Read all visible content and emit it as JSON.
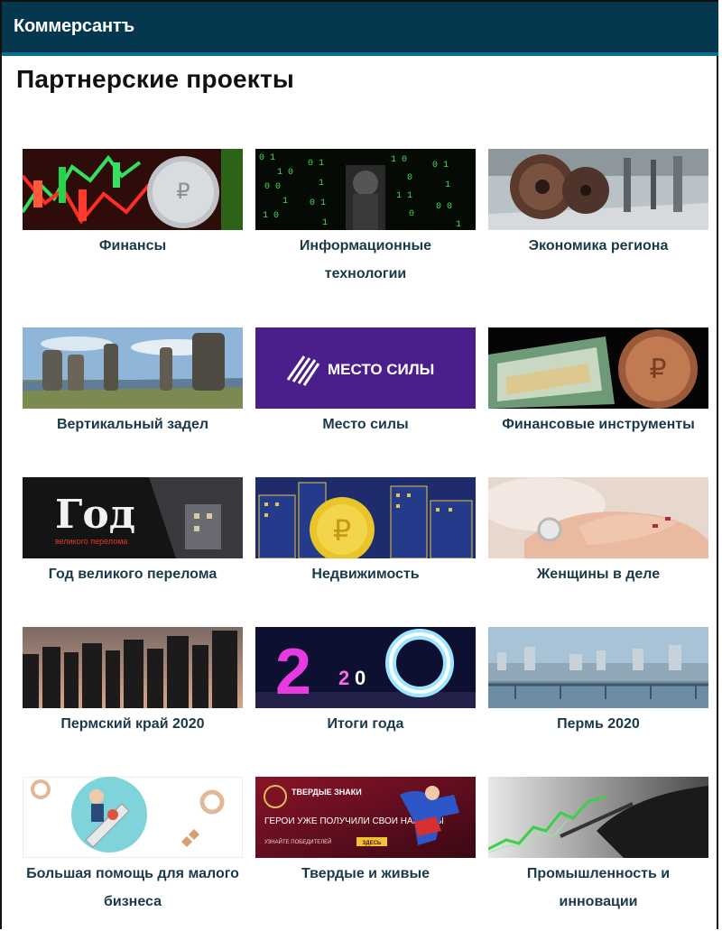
{
  "header": {
    "logo": "Коммерсантъ"
  },
  "page": {
    "title": "Партнерские проекты"
  },
  "projects": [
    {
      "label": "Финансы"
    },
    {
      "label": "Информационные технологии"
    },
    {
      "label": "Экономика региона"
    },
    {
      "label": "Вертикальный задел"
    },
    {
      "label": "Место силы",
      "image_text": "МЕСТО СИЛЫ"
    },
    {
      "label": "Финансовые инструменты"
    },
    {
      "label": "Год великого перелома",
      "image_text": "Год",
      "image_subtext": "великого перелома"
    },
    {
      "label": "Недвижимость"
    },
    {
      "label": "Женщины в деле"
    },
    {
      "label": "Пермский край 2020"
    },
    {
      "label": "Итоги года",
      "image_text": "2020"
    },
    {
      "label": "Пермь 2020"
    },
    {
      "label": "Большая помощь для малого бизнеса"
    },
    {
      "label": "Твердые и живые",
      "image_brand": "ТВЕРДЫЕ ЗНАКИ",
      "image_text": "ГЕРОИ УЖЕ ПОЛУЧИЛИ СВОИ НАГРАДЫ",
      "image_subtext": "УЗНАЙТЕ ПОБЕДИТЕЛЕЙ",
      "image_button": "ЗДЕСЬ"
    },
    {
      "label": "Промышленность и инновации"
    }
  ]
}
